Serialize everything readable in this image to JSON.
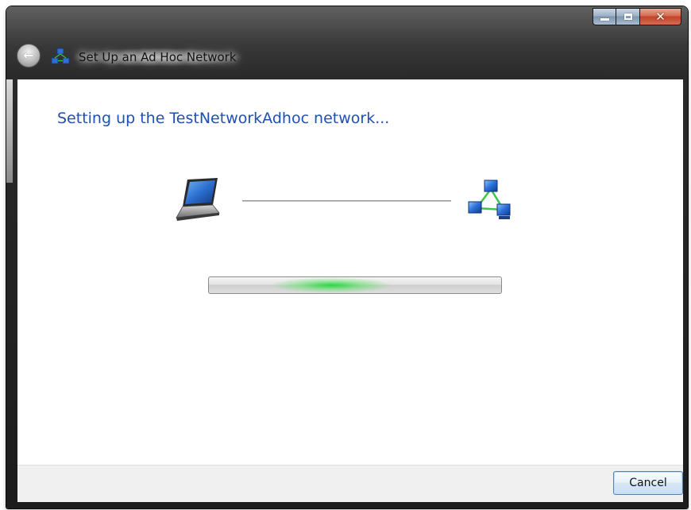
{
  "window": {
    "title": "Set Up an Ad Hoc Network",
    "title_icon": "network-icon",
    "back_icon": "back-arrow-icon",
    "caption_buttons": {
      "minimize_icon": "minimize-icon",
      "maximize_icon": "maximize-icon",
      "close_icon": "close-icon",
      "close_glyph": "✕"
    }
  },
  "main": {
    "heading": "Setting up the TestNetworkAdhoc network...",
    "source_icon": "laptop-icon",
    "target_icon": "network-icon",
    "progress": {
      "state": "indeterminate",
      "glow_center": 0.42,
      "colors": {
        "glow": "#2ecc40"
      }
    }
  },
  "footer": {
    "cancel_label": "Cancel"
  },
  "colors": {
    "heading": "#1e4fb3",
    "frame": "#1c1c1c",
    "close_button": "#c0432a",
    "footer_bg": "#f0f0f0"
  }
}
